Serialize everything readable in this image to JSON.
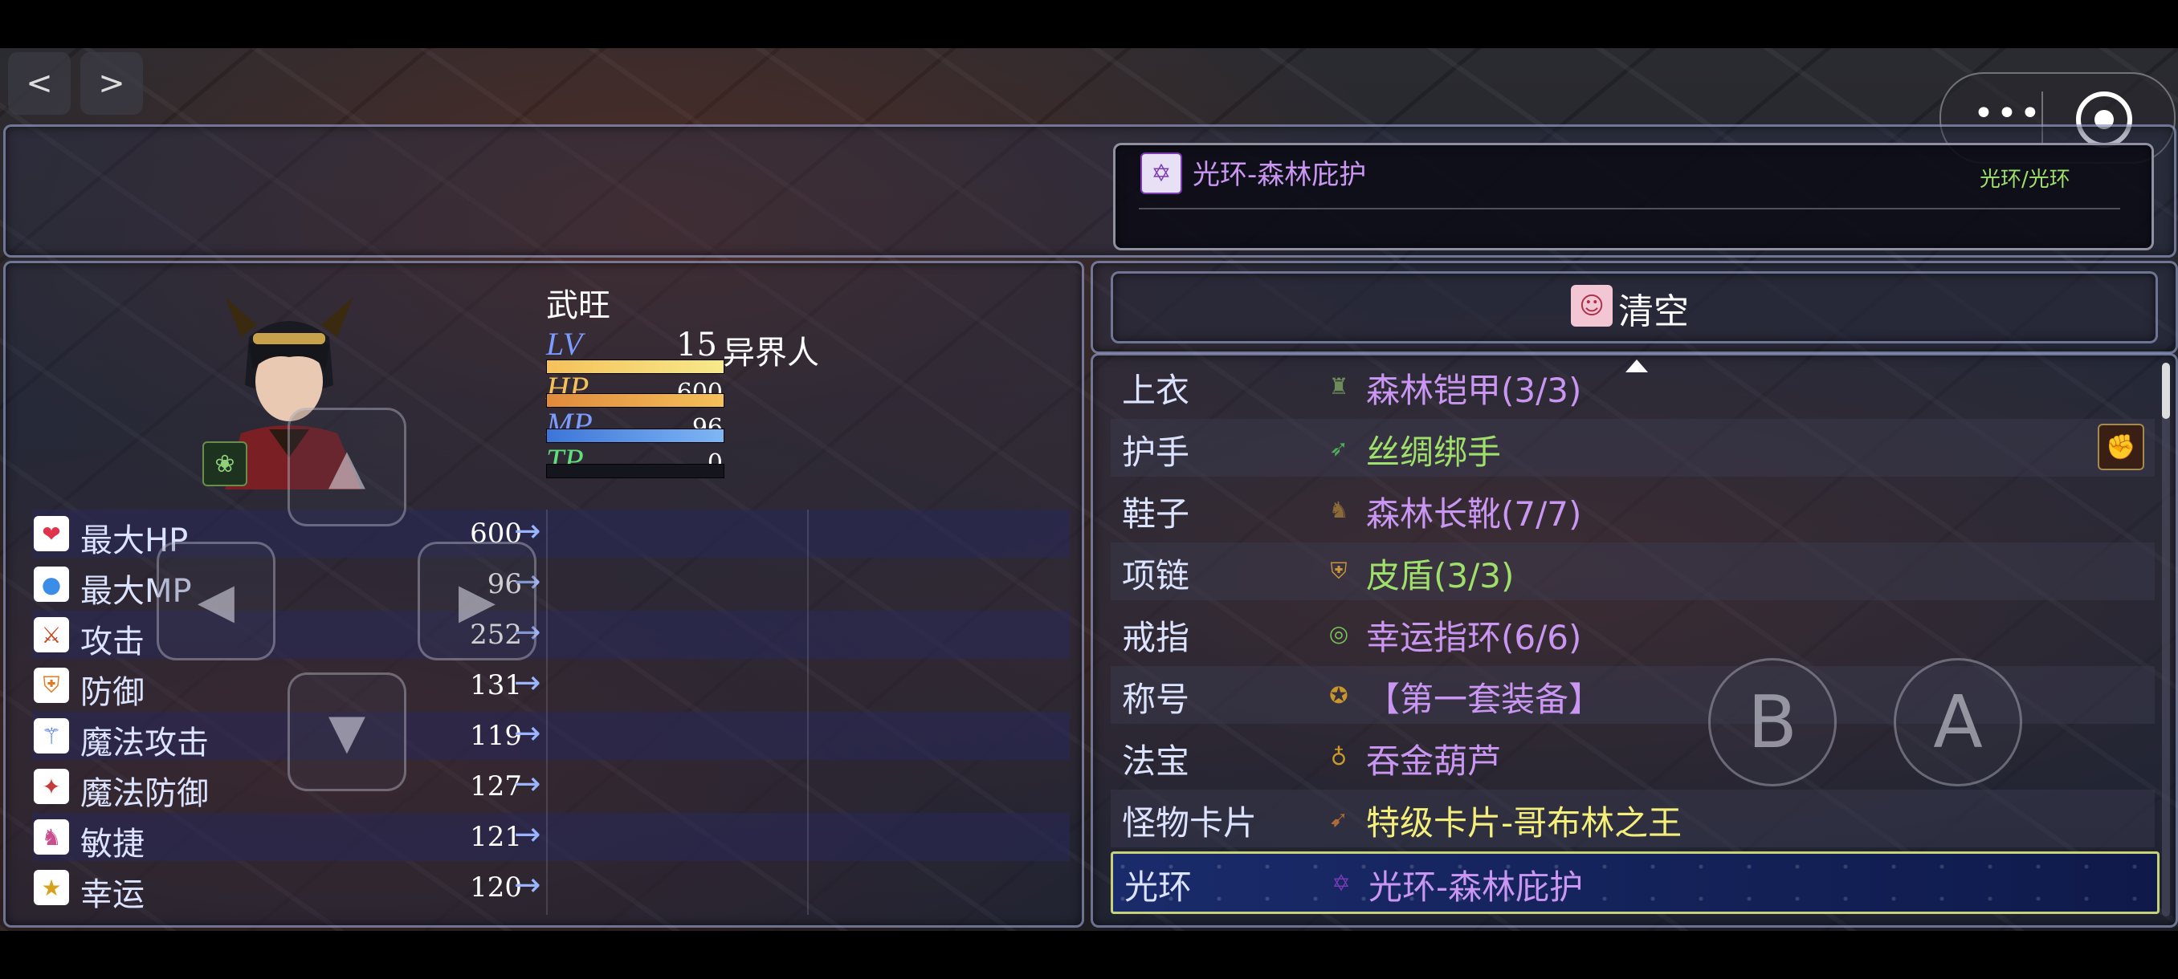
{
  "nav": {
    "prev": "<",
    "next": ">"
  },
  "mini_program": {
    "more": "•••",
    "close_icon": "target-circle-icon"
  },
  "help": {
    "item_name": "光环-森林庇护",
    "item_type": "光环/光环"
  },
  "command": {
    "clear_label": "清空"
  },
  "actor": {
    "name": "武旺",
    "level_label": "LV",
    "level": "15",
    "class": "异界人",
    "hp_label": "HP",
    "hp": "600",
    "hp_rate": 1.0,
    "mp_label": "MP",
    "mp": "96",
    "mp_rate": 1.0,
    "tp_label": "TP",
    "tp": "0",
    "tp_rate": 0.0
  },
  "params": [
    {
      "name": "最大HP",
      "value": "600",
      "arrow": "→",
      "icon": "heart-icon"
    },
    {
      "name": "最大MP",
      "value": "96",
      "arrow": "→",
      "icon": "mana-orb-icon"
    },
    {
      "name": "攻击",
      "value": "252",
      "arrow": "→",
      "icon": "sword-icon"
    },
    {
      "name": "防御",
      "value": "131",
      "arrow": "→",
      "icon": "shield-icon"
    },
    {
      "name": "魔法攻击",
      "value": "119",
      "arrow": "→",
      "icon": "wand-icon"
    },
    {
      "name": "魔法防御",
      "value": "127",
      "arrow": "→",
      "icon": "magic-shield-icon"
    },
    {
      "name": "敏捷",
      "value": "121",
      "arrow": "→",
      "icon": "boot-icon"
    },
    {
      "name": "幸运",
      "value": "120",
      "arrow": "→",
      "icon": "stars-icon"
    }
  ],
  "slots": [
    {
      "slot": "上衣",
      "item": "森林铠甲(3/3)",
      "color": "#c996f2",
      "icon": "armor-icon"
    },
    {
      "slot": "护手",
      "item": "丝绸绑手",
      "color": "#9ee06a",
      "icon": "bandage-icon"
    },
    {
      "slot": "鞋子",
      "item": "森林长靴(7/7)",
      "color": "#c996f2",
      "icon": "boots-icon"
    },
    {
      "slot": "项链",
      "item": "皮盾(3/3)",
      "color": "#9ee06a",
      "icon": "small-shield-icon"
    },
    {
      "slot": "戒指",
      "item": "幸运指环(6/6)",
      "color": "#c996f2",
      "icon": "ring-icon"
    },
    {
      "slot": "称号",
      "item": "【第一套装备】",
      "color": "#c996f2",
      "icon": "medal-icon"
    },
    {
      "slot": "法宝",
      "item": "吞金葫芦",
      "color": "#c996f2",
      "icon": "gourd-icon"
    },
    {
      "slot": "怪物卡片",
      "item": "特级卡片-哥布林之王",
      "color": "#f3ef7a",
      "icon": "card-icon"
    },
    {
      "slot": "光环",
      "item": "光环-森林庇护",
      "color": "#c996f2",
      "icon": "hexagram-icon"
    }
  ],
  "gamepad": {
    "b_label": "B",
    "a_label": "A"
  }
}
